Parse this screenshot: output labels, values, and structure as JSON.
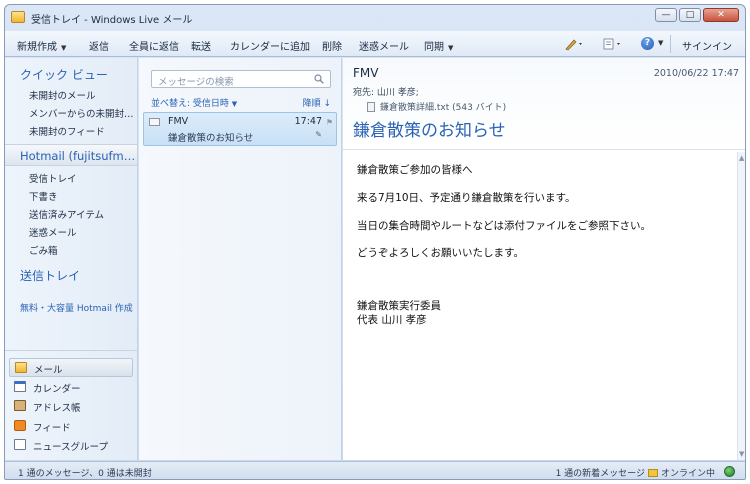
{
  "window": {
    "title": "受信トレイ - Windows Live メール",
    "controls": [
      "—",
      "□",
      "✕"
    ]
  },
  "toolbar": {
    "new": "新規作成",
    "reply": "返信",
    "reply_all": "全員に返信",
    "forward": "転送",
    "add_calendar": "カレンダーに追加",
    "delete": "削除",
    "junk": "迷惑メール",
    "sync": "同期",
    "signin": "サインイン",
    "help": "?"
  },
  "left_pane": {
    "quick_view": {
      "title": "クイック ビュー",
      "items": [
        "未開封のメール",
        "メンバーからの未開封…",
        "未開封のフィード"
      ]
    },
    "account": {
      "title": "Hotmail (fujitsufm…",
      "folders": [
        "受信トレイ",
        "下書き",
        "送信済みアイテム",
        "迷惑メール",
        "ごみ箱"
      ]
    },
    "outbox": "送信トレイ",
    "create_link": "無料・大容量 Hotmail 作成",
    "modules": [
      "メール",
      "カレンダー",
      "アドレス帳",
      "フィード",
      "ニュースグループ"
    ]
  },
  "message_list": {
    "search_placeholder": "メッセージの検索",
    "sort_label": "並べ替え: 受信日時",
    "order_label": "降順",
    "messages": [
      {
        "from": "FMV",
        "time": "17:47",
        "subject": "鎌倉散策のお知らせ"
      }
    ]
  },
  "reading_pane": {
    "from": "FMV",
    "date": "2010/06/22 17:47",
    "to": "宛先:  山川 孝彦;",
    "attachment": "鎌倉散策詳細.txt (543 バイト)",
    "subject": "鎌倉散策のお知らせ",
    "body": [
      "鎌倉散策ご参加の皆様へ",
      "来る7月10日、予定通り鎌倉散策を行います。",
      "当日の集合時間やルートなどは添付ファイルをご参照下さい。",
      "どうぞよろしくお願いいたします。",
      "鎌倉散策実行委員",
      "代表  山川  孝彦"
    ]
  },
  "status_bar": {
    "left": "1 通のメッセージ、0 通は未開封",
    "right": "1 通の新着メッセージ",
    "online": "オンライン中"
  }
}
